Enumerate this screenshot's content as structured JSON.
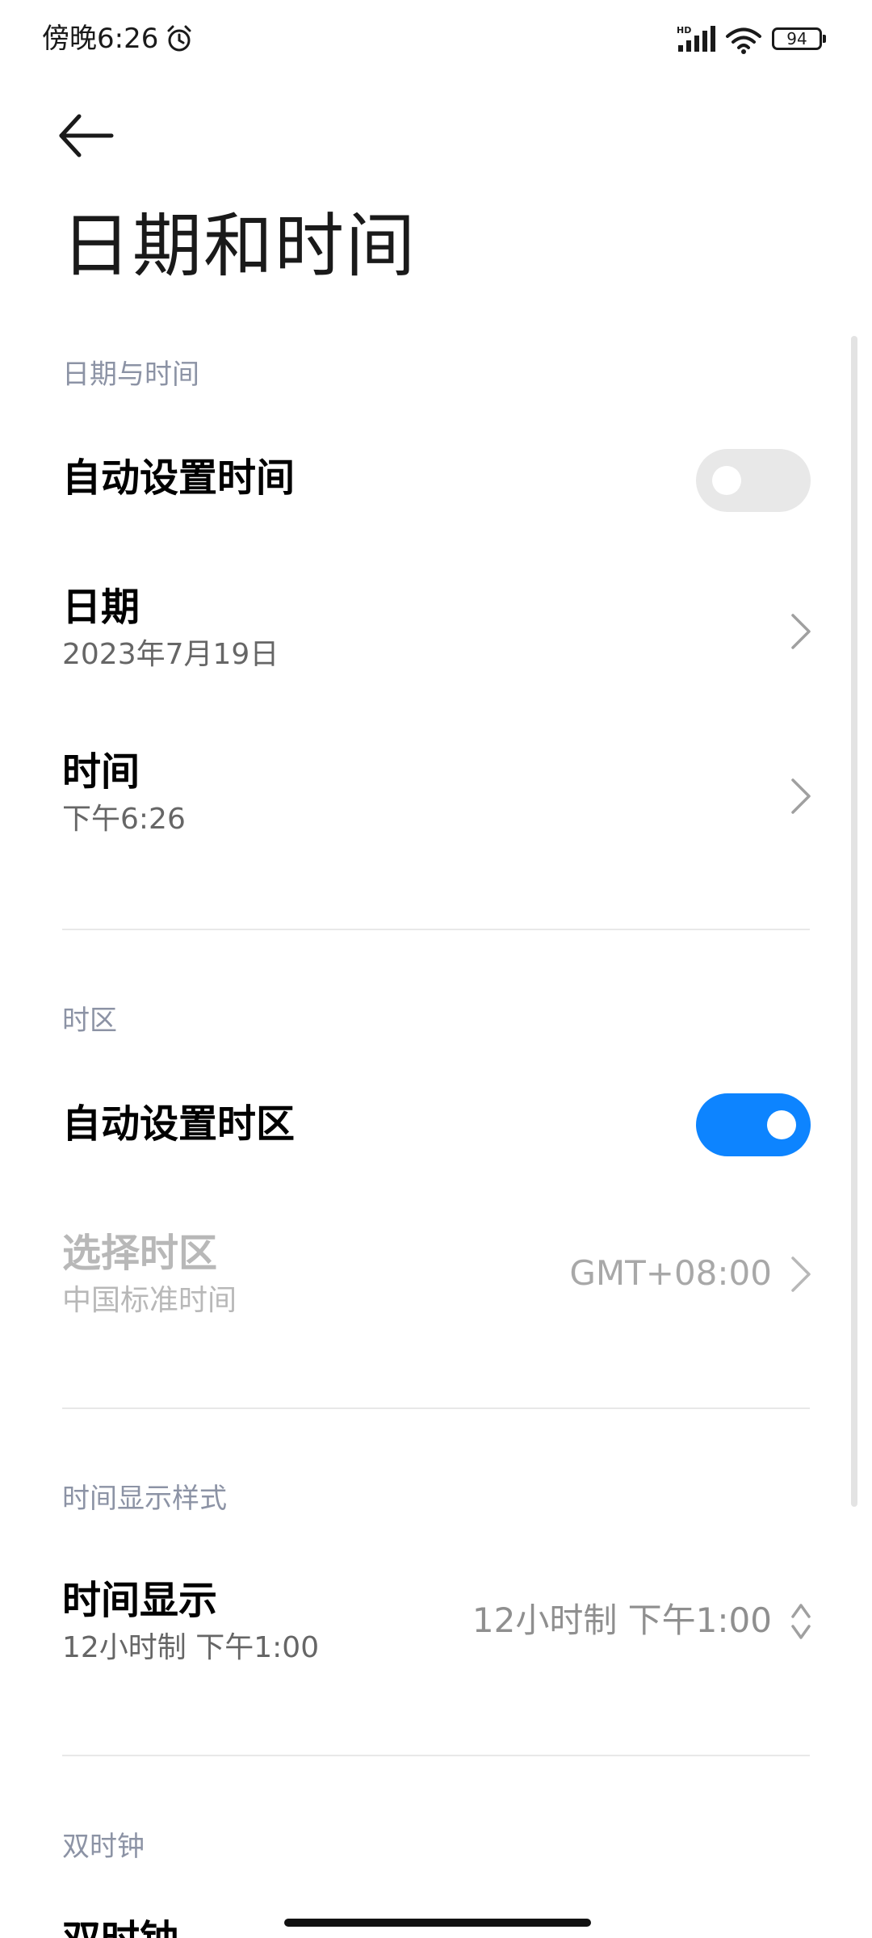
{
  "status_bar": {
    "time": "傍晚6:26",
    "network_badge": "HD",
    "battery_level": "94"
  },
  "header": {
    "title": "日期和时间"
  },
  "sections": {
    "date_time": {
      "header": "日期与时间",
      "auto_time": {
        "title": "自动设置时间",
        "enabled": false
      },
      "date": {
        "title": "日期",
        "value": "2023年7月19日"
      },
      "time": {
        "title": "时间",
        "value": "下午6:26"
      }
    },
    "timezone": {
      "header": "时区",
      "auto_timezone": {
        "title": "自动设置时区",
        "enabled": true
      },
      "select_timezone": {
        "title": "选择时区",
        "subtitle": "中国标准时间",
        "value": "GMT+08:00"
      }
    },
    "time_format": {
      "header": "时间显示样式",
      "time_display": {
        "title": "时间显示",
        "subtitle": "12小时制 下午1:00",
        "value": "12小时制 下午1:00"
      }
    },
    "dual_clock": {
      "header": "双时钟",
      "dual_clock_row": {
        "title": "双时钟"
      }
    }
  },
  "colors": {
    "accent": "#0d84ff",
    "section_header": "#8c93a5",
    "toggle_off": "#e8e8e8"
  }
}
